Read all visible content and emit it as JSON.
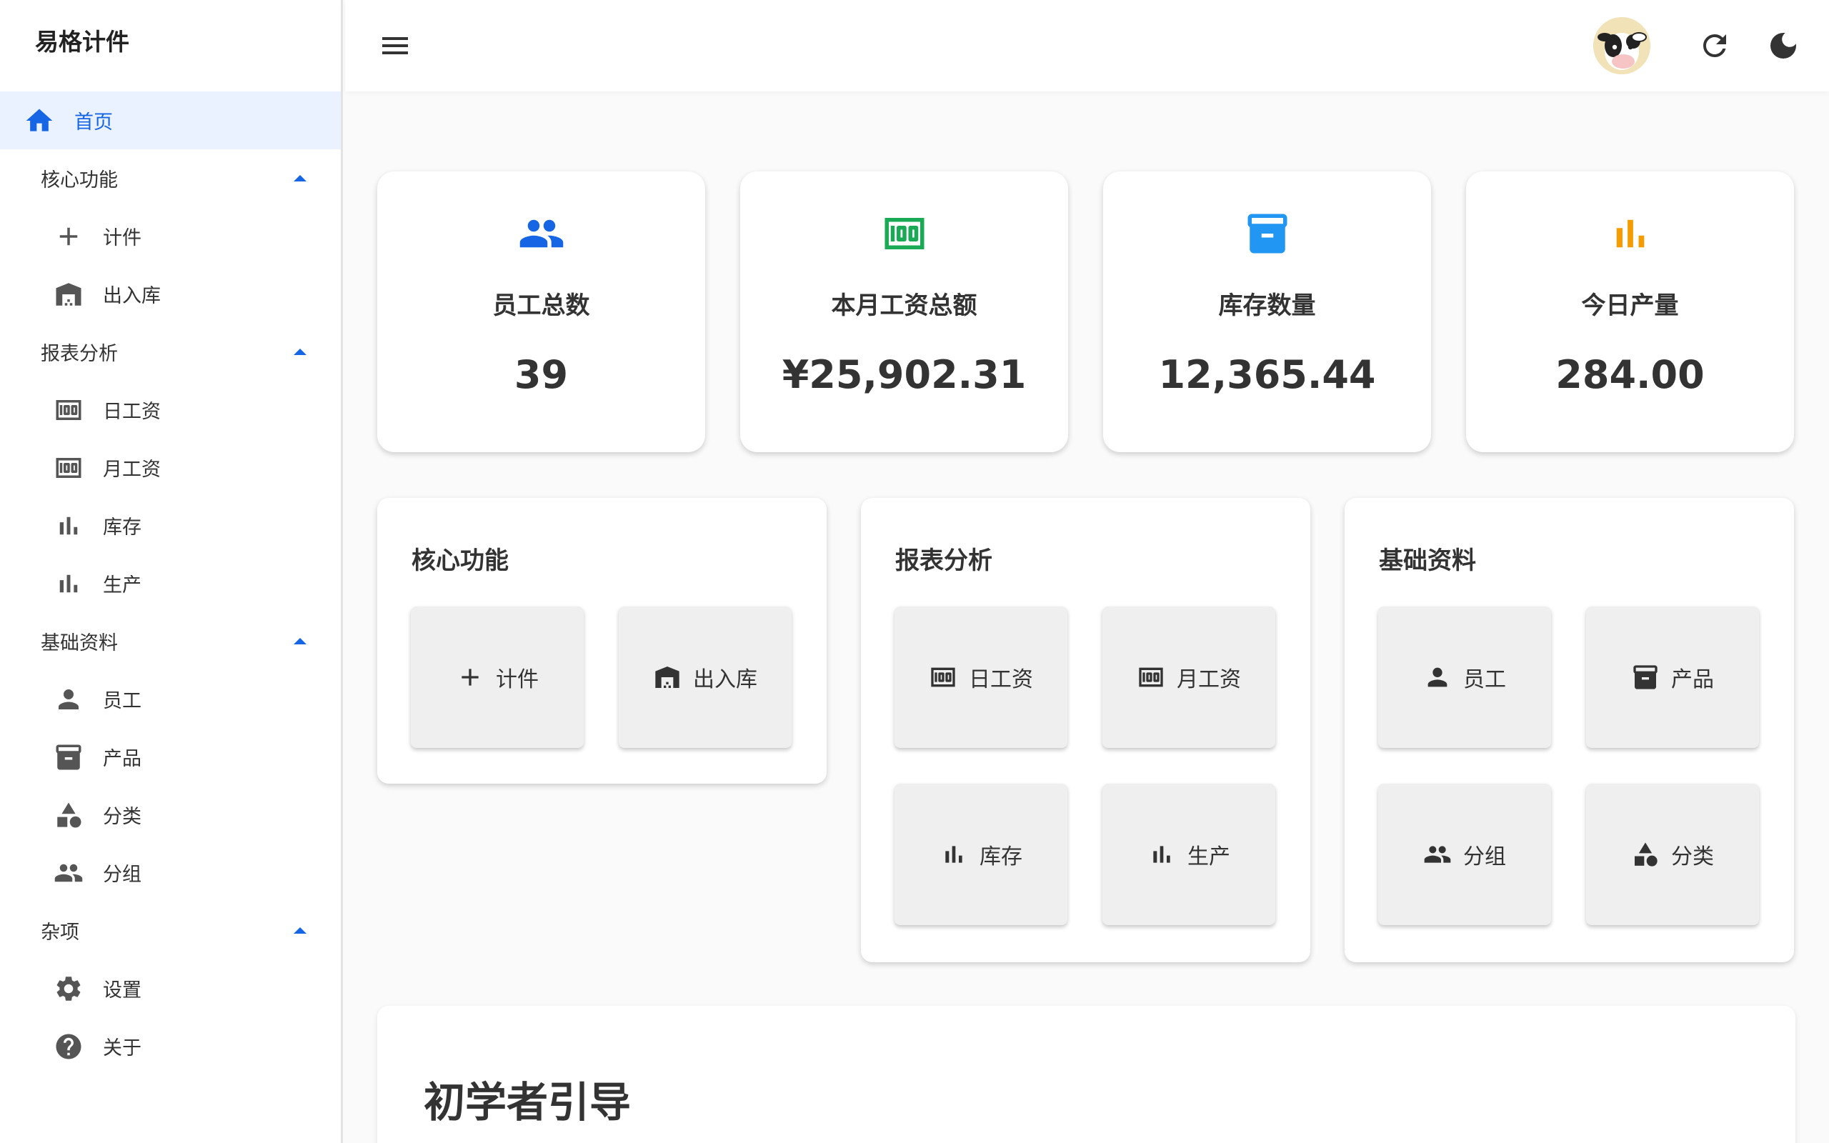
{
  "brand": "易格计件",
  "sidebar": {
    "home": "首页",
    "groups": [
      {
        "label": "核心功能",
        "items": [
          {
            "label": "计件",
            "icon": "plus-icon"
          },
          {
            "label": "出入库",
            "icon": "warehouse-icon"
          }
        ]
      },
      {
        "label": "报表分析",
        "items": [
          {
            "label": "日工资",
            "icon": "money-icon"
          },
          {
            "label": "月工资",
            "icon": "money-icon"
          },
          {
            "label": "库存",
            "icon": "bar-chart-icon"
          },
          {
            "label": "生产",
            "icon": "bar-chart-icon"
          }
        ]
      },
      {
        "label": "基础资料",
        "items": [
          {
            "label": "员工",
            "icon": "person-icon"
          },
          {
            "label": "产品",
            "icon": "archive-icon"
          },
          {
            "label": "分类",
            "icon": "category-icon"
          },
          {
            "label": "分组",
            "icon": "group-icon"
          }
        ]
      },
      {
        "label": "杂项",
        "items": [
          {
            "label": "设置",
            "icon": "gear-icon"
          },
          {
            "label": "关于",
            "icon": "help-icon"
          }
        ]
      }
    ]
  },
  "topbar": {
    "menu_icon": "menu-icon",
    "avatar": "cow-avatar",
    "refresh_icon": "refresh-icon",
    "theme_icon": "moon-icon"
  },
  "stats": [
    {
      "label": "员工总数",
      "value": "39",
      "icon": "group-icon",
      "color": "#1565e5"
    },
    {
      "label": "本月工资总额",
      "value": "¥25,902.31",
      "icon": "money-icon",
      "color": "#1aaa55"
    },
    {
      "label": "库存数量",
      "value": "12,365.44",
      "icon": "archive-icon",
      "color": "#2196f3"
    },
    {
      "label": "今日产量",
      "value": "284.00",
      "icon": "bar-chart-icon",
      "color": "#f59c00"
    }
  ],
  "sections": {
    "core": {
      "title": "核心功能",
      "tiles": [
        "计件",
        "出入库"
      ]
    },
    "reports": {
      "title": "报表分析",
      "tiles": [
        "日工资",
        "月工资",
        "库存",
        "生产"
      ]
    },
    "basic": {
      "title": "基础资料",
      "tiles": [
        "员工",
        "产品",
        "分组",
        "分类"
      ]
    }
  },
  "guide": {
    "title": "初学者引导"
  },
  "colors": {
    "accent": "#1565e5",
    "home_bg": "#eaf2ff"
  }
}
